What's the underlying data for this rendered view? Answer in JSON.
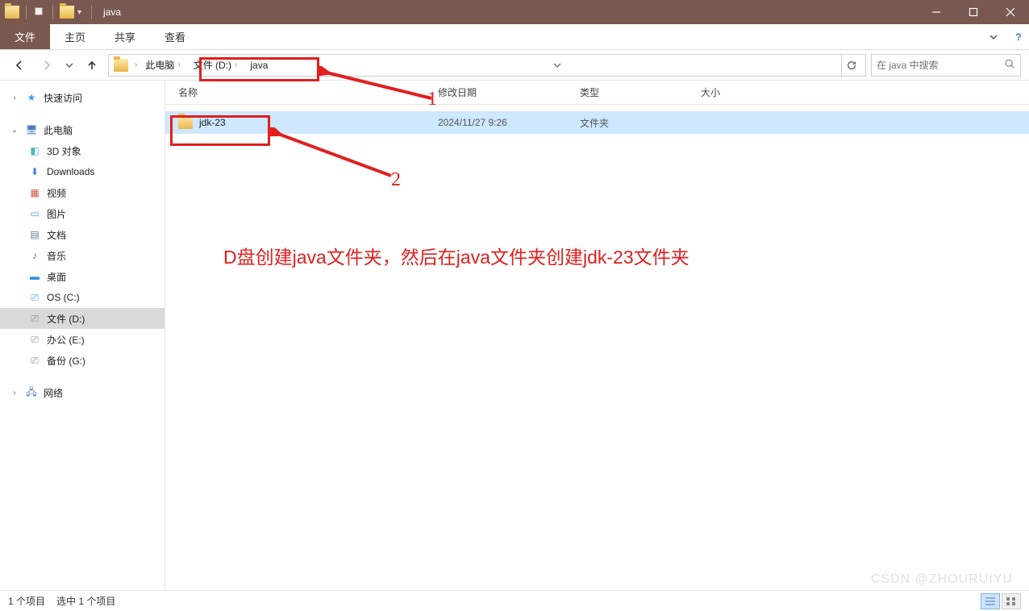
{
  "window": {
    "title": "java"
  },
  "ribbon": {
    "file": "文件",
    "tabs": [
      "主页",
      "共享",
      "查看"
    ]
  },
  "breadcrumb": {
    "root": "此电脑",
    "drive": "文件 (D:)",
    "folder": "java"
  },
  "search": {
    "placeholder": "在 java 中搜索"
  },
  "sidebar": {
    "quick": "快速访问",
    "pc": "此电脑",
    "items": {
      "objects3d": "3D 对象",
      "downloads": "Downloads",
      "videos": "视频",
      "pictures": "图片",
      "documents": "文档",
      "music": "音乐",
      "desktop": "桌面",
      "osc": "OS (C:)",
      "filed": "文件 (D:)",
      "officee": "办公 (E:)",
      "backupg": "备份 (G:)"
    },
    "network": "网络"
  },
  "columns": {
    "name": "名称",
    "date": "修改日期",
    "type": "类型",
    "size": "大小"
  },
  "files": [
    {
      "name": "jdk-23",
      "date": "2024/11/27 9:26",
      "type": "文件夹",
      "size": ""
    }
  ],
  "annotations": {
    "num1": "1",
    "num2": "2",
    "text": "D盘创建java文件夹，然后在java文件夹创建jdk-23文件夹"
  },
  "status": {
    "count": "1 个项目",
    "selection": "选中 1 个项目"
  },
  "watermark": "CSDN @ZHOURUIYU"
}
